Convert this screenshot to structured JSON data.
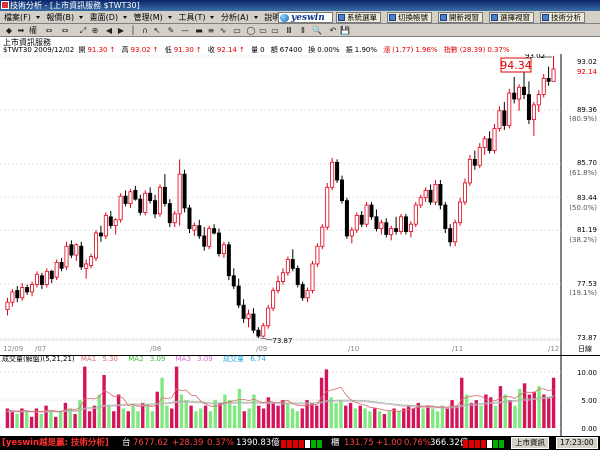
{
  "window": {
    "title": "技術分析 - [上市資訊服務 $TWT30]"
  },
  "menu": {
    "items": [
      {
        "label": "檔案(F)"
      },
      {
        "label": "報價(B)"
      },
      {
        "label": "畫面(D)"
      },
      {
        "label": "管理(M)"
      },
      {
        "label": "工具(T)"
      },
      {
        "label": "分析(A)"
      },
      {
        "label": "說明(H)"
      }
    ],
    "brand": "yeswin",
    "buttons": [
      {
        "label": "系統選單"
      },
      {
        "label": "切換帳號"
      },
      {
        "label": "開新視窗"
      },
      {
        "label": "選擇視窗"
      },
      {
        "label": "技術分析"
      }
    ]
  },
  "toolbar": {
    "items": [
      "◆",
      "➡",
      "權",
      "⇔",
      "⇔",
      "⤢",
      "⊕",
      "◀",
      "▶",
      "│",
      "∩",
      "↖",
      "✎",
      "—",
      "▬",
      "≡",
      "∿",
      "▭",
      "◯",
      "▭",
      "▭",
      "Ⅲ",
      "Ⅱ",
      "🔍",
      "↶",
      "💾"
    ]
  },
  "stock": {
    "name": "上市資訊服務",
    "symbol": "$TWT30",
    "date": "2009/12/02",
    "open_label": "開",
    "open": "91.30",
    "high_label": "高",
    "high": "93.02",
    "low_label": "低",
    "low": "91.30",
    "close_label": "收",
    "close": "92.14",
    "qty_label": "量",
    "qty": "0",
    "amount_label": "額",
    "amount": "67400",
    "turnover_label": "換",
    "turnover": "0.00%",
    "range_label": "振",
    "range": "1.90%",
    "change_label": "漲",
    "change": "(1.77)",
    "change_pct": "1.96%",
    "index_label": "指數",
    "index_change": "(28.39)",
    "index_pct": "0.37%"
  },
  "chart_data": [
    {
      "type": "candlestick",
      "title": "上市資訊服務 $TWT30",
      "x_range": [
        "2009/06",
        "2009/12/02"
      ],
      "x_tick_labels": [
        "12/09",
        "/07",
        "/08",
        "/09",
        "/10",
        "/11",
        "/12"
      ],
      "y_tick_labels": [
        "93.02",
        "92.14",
        "89.36",
        "(80.9%)",
        "85.70",
        "(61.8%)",
        "83.44",
        "(50.0%)",
        "81.19",
        "(38.2%)",
        "77.53",
        "(19.1%)",
        "73.87"
      ],
      "ylim": [
        73.87,
        93.02
      ],
      "highlight_price": "94.34",
      "high_annotation": "93.02",
      "low_annotation": "73.87",
      "ohlc": [
        [
          75.8,
          76.6,
          75.4,
          76.3
        ],
        [
          76.3,
          77.2,
          76.0,
          77.0
        ],
        [
          77.1,
          77.4,
          76.3,
          76.6
        ],
        [
          76.6,
          77.6,
          76.4,
          77.3
        ],
        [
          77.3,
          77.5,
          76.8,
          77.0
        ],
        [
          77.0,
          77.7,
          76.7,
          77.5
        ],
        [
          77.5,
          78.4,
          77.3,
          78.2
        ],
        [
          78.1,
          78.3,
          77.2,
          77.5
        ],
        [
          77.5,
          78.6,
          77.3,
          78.4
        ],
        [
          78.4,
          78.5,
          77.6,
          77.9
        ],
        [
          78.0,
          79.2,
          77.8,
          79.0
        ],
        [
          79.0,
          79.3,
          78.4,
          78.6
        ],
        [
          78.7,
          80.4,
          78.5,
          80.1
        ],
        [
          80.2,
          80.5,
          79.3,
          79.5
        ],
        [
          79.5,
          80.3,
          79.1,
          80.2
        ],
        [
          80.1,
          80.4,
          78.5,
          78.7
        ],
        [
          78.6,
          79.2,
          77.9,
          78.9
        ],
        [
          78.8,
          79.6,
          78.6,
          79.4
        ],
        [
          79.3,
          81.2,
          79.1,
          81.0
        ],
        [
          81.0,
          81.5,
          80.4,
          80.8
        ],
        [
          80.8,
          82.4,
          80.6,
          82.2
        ],
        [
          82.1,
          82.5,
          81.3,
          81.5
        ],
        [
          81.5,
          82.0,
          80.9,
          81.9
        ],
        [
          81.9,
          83.7,
          81.7,
          83.5
        ],
        [
          83.5,
          83.9,
          82.8,
          83.0
        ],
        [
          83.0,
          84.0,
          82.7,
          83.8
        ],
        [
          83.9,
          84.2,
          83.2,
          83.3
        ],
        [
          83.3,
          83.6,
          82.2,
          82.4
        ],
        [
          82.4,
          83.9,
          82.2,
          83.7
        ],
        [
          83.7,
          84.1,
          83.0,
          83.2
        ],
        [
          83.2,
          83.6,
          82.0,
          82.3
        ],
        [
          82.3,
          84.3,
          82.1,
          84.1
        ],
        [
          84.1,
          85.0,
          82.8,
          83.0
        ],
        [
          83.0,
          83.3,
          81.4,
          81.7
        ],
        [
          81.7,
          82.5,
          81.4,
          82.3
        ],
        [
          82.3,
          86.0,
          81.5,
          85.0
        ],
        [
          85.0,
          85.3,
          82.4,
          82.7
        ],
        [
          82.7,
          82.9,
          81.0,
          81.3
        ],
        [
          81.2,
          81.7,
          80.8,
          81.5
        ],
        [
          81.5,
          81.9,
          80.6,
          80.8
        ],
        [
          80.8,
          81.4,
          79.8,
          80.1
        ],
        [
          80.1,
          81.5,
          79.9,
          81.3
        ],
        [
          81.3,
          81.6,
          80.9,
          81.0
        ],
        [
          81.0,
          81.3,
          79.4,
          79.6
        ],
        [
          79.6,
          80.4,
          79.3,
          80.2
        ],
        [
          80.2,
          80.4,
          77.8,
          78.1
        ],
        [
          78.1,
          78.6,
          77.2,
          77.4
        ],
        [
          77.4,
          77.9,
          75.9,
          76.1
        ],
        [
          76.1,
          76.5,
          74.9,
          75.2
        ],
        [
          75.2,
          75.8,
          74.6,
          75.5
        ],
        [
          75.5,
          75.9,
          74.2,
          74.4
        ],
        [
          74.4,
          74.6,
          73.87,
          74.0
        ],
        [
          74.0,
          74.9,
          73.9,
          74.7
        ],
        [
          74.7,
          76.1,
          74.5,
          75.9
        ],
        [
          75.9,
          77.3,
          75.7,
          77.1
        ],
        [
          77.1,
          78.1,
          76.9,
          77.7
        ],
        [
          77.7,
          78.6,
          77.5,
          78.3
        ],
        [
          78.3,
          79.4,
          78.1,
          79.2
        ],
        [
          79.2,
          79.9,
          78.4,
          78.6
        ],
        [
          78.6,
          78.8,
          77.3,
          77.5
        ],
        [
          77.5,
          77.7,
          76.4,
          76.6
        ],
        [
          76.6,
          77.3,
          76.3,
          77.1
        ],
        [
          77.1,
          79.1,
          76.9,
          78.9
        ],
        [
          78.9,
          80.3,
          78.7,
          80.1
        ],
        [
          80.1,
          81.6,
          79.9,
          81.4
        ],
        [
          81.4,
          84.4,
          81.2,
          84.1
        ],
        [
          84.1,
          86.1,
          83.9,
          85.8
        ],
        [
          85.8,
          86.0,
          84.4,
          84.6
        ],
        [
          84.6,
          84.9,
          83.0,
          83.2
        ],
        [
          83.2,
          83.4,
          80.6,
          80.8
        ],
        [
          80.8,
          81.4,
          80.3,
          81.2
        ],
        [
          81.2,
          82.4,
          81.0,
          82.2
        ],
        [
          82.2,
          82.5,
          81.4,
          81.6
        ],
        [
          81.6,
          83.1,
          81.4,
          82.9
        ],
        [
          82.9,
          83.1,
          81.9,
          82.1
        ],
        [
          82.1,
          82.6,
          81.1,
          81.3
        ],
        [
          81.3,
          81.9,
          80.9,
          81.7
        ],
        [
          81.7,
          82.0,
          80.7,
          80.9
        ],
        [
          80.9,
          81.5,
          80.5,
          81.3
        ],
        [
          81.3,
          82.1,
          80.9,
          81.1
        ],
        [
          81.1,
          82.3,
          80.9,
          82.1
        ],
        [
          82.1,
          82.3,
          80.9,
          81.1
        ],
        [
          81.1,
          81.8,
          80.7,
          81.6
        ],
        [
          81.6,
          83.1,
          81.4,
          82.9
        ],
        [
          82.9,
          83.6,
          82.7,
          83.4
        ],
        [
          83.4,
          84.1,
          83.1,
          83.9
        ],
        [
          83.9,
          84.3,
          82.9,
          83.1
        ],
        [
          83.1,
          84.6,
          82.9,
          84.3
        ],
        [
          84.3,
          84.6,
          82.6,
          82.9
        ],
        [
          82.9,
          83.1,
          81.0,
          81.3
        ],
        [
          81.3,
          81.6,
          80.1,
          80.4
        ],
        [
          80.4,
          81.9,
          80.1,
          81.7
        ],
        [
          81.7,
          83.4,
          81.5,
          83.1
        ],
        [
          83.1,
          84.7,
          82.9,
          84.4
        ],
        [
          84.4,
          86.3,
          84.2,
          86.0
        ],
        [
          86.0,
          86.6,
          85.3,
          85.6
        ],
        [
          85.6,
          87.1,
          85.4,
          86.8
        ],
        [
          86.8,
          87.6,
          86.3,
          87.4
        ],
        [
          87.4,
          87.9,
          86.4,
          86.6
        ],
        [
          86.6,
          88.4,
          86.4,
          88.1
        ],
        [
          88.1,
          89.6,
          87.9,
          89.3
        ],
        [
          89.3,
          89.9,
          88.0,
          88.3
        ],
        [
          88.3,
          90.8,
          88.1,
          90.5
        ],
        [
          90.5,
          91.6,
          89.8,
          90.1
        ],
        [
          90.1,
          91.1,
          89.3,
          90.9
        ],
        [
          90.9,
          91.9,
          90.1,
          90.4
        ],
        [
          90.4,
          91.3,
          88.4,
          88.7
        ],
        [
          88.7,
          89.9,
          87.6,
          89.7
        ],
        [
          89.7,
          90.7,
          89.2,
          90.4
        ],
        [
          90.4,
          91.8,
          90.2,
          91.5
        ],
        [
          91.5,
          92.3,
          91.0,
          91.3
        ],
        [
          91.3,
          93.02,
          91.3,
          92.14
        ]
      ]
    },
    {
      "type": "bar",
      "title": "成交量(解盤)(5,21,21)",
      "legend": [
        {
          "name": "MA1",
          "value": "5.30"
        },
        {
          "name": "MA2",
          "value": "3.09"
        },
        {
          "name": "MA3",
          "value": "3.09"
        },
        {
          "name": "成交量",
          "value": "6.74"
        }
      ],
      "y_tick_labels": [
        "10.00",
        "5.00",
        "0.00"
      ],
      "ylim": [
        0,
        12
      ],
      "values": [
        3.5,
        3.0,
        2.5,
        3.5,
        3.0,
        2.0,
        3.5,
        2.5,
        4.0,
        3.0,
        2.0,
        3.0,
        4.5,
        3.5,
        2.5,
        5.0,
        11.0,
        3.0,
        4.0,
        6.0,
        9.5,
        4.0,
        3.0,
        6.0,
        3.5,
        3.0,
        4.0,
        3.0,
        4.5,
        4.0,
        3.0,
        6.5,
        9.0,
        4.0,
        3.5,
        11.0,
        6.0,
        5.0,
        4.0,
        3.0,
        3.5,
        4.0,
        3.0,
        5.0,
        4.5,
        6.0,
        5.0,
        4.0,
        7.0,
        3.0,
        3.5,
        6.0,
        4.0,
        3.5,
        5.5,
        4.5,
        4.0,
        5.0,
        4.5,
        3.5,
        3.0,
        3.5,
        5.0,
        4.5,
        4.0,
        9.0,
        10.5,
        5.5,
        4.5,
        5.0,
        4.0,
        4.5,
        3.5,
        4.0,
        3.5,
        3.0,
        3.5,
        3.0,
        2.5,
        3.0,
        3.5,
        3.0,
        3.5,
        4.0,
        3.5,
        4.5,
        3.5,
        4.0,
        3.5,
        3.0,
        4.0,
        3.5,
        5.0,
        4.0,
        9.0,
        6.0,
        4.5,
        5.0,
        4.0,
        6.0,
        5.5,
        4.0,
        7.5,
        6.0,
        5.0,
        4.0,
        7.0,
        8.0,
        6.0,
        6.5,
        7.5,
        6.0,
        5.5,
        9.0
      ],
      "ma1": [
        3.2,
        3.1,
        3.0,
        3.1,
        3.1,
        2.9,
        3.0,
        2.9,
        3.1,
        3.2,
        3.0,
        2.9,
        3.3,
        3.4,
        3.3,
        3.6,
        5.3,
        5.3,
        5.2,
        5.6,
        6.7,
        6.3,
        5.6,
        5.8,
        5.3,
        4.0,
        4.2,
        3.9,
        3.9,
        4.1,
        3.8,
        4.2,
        5.4,
        5.3,
        5.4,
        7.0,
        6.7,
        6.8,
        5.9,
        5.8,
        4.8,
        4.3,
        3.9,
        3.9,
        4.0,
        4.5,
        4.7,
        4.9,
        5.1,
        5.1,
        4.9,
        5.2,
        4.8,
        4.5,
        4.8,
        4.6,
        4.5,
        4.8,
        4.9,
        4.4,
        4.1,
        4.0,
        4.0,
        4.1,
        4.2,
        5.5,
        6.5,
        6.8,
        7.0,
        7.3,
        6.0,
        5.1,
        4.6,
        4.3,
        4.1,
        3.7,
        3.6,
        3.4,
        3.2,
        3.1,
        3.1,
        3.0,
        3.1,
        3.3,
        3.5,
        3.7,
        3.9,
        4.0,
        3.9,
        3.7,
        3.8,
        3.7,
        3.9,
        3.9,
        5.1,
        5.5,
        5.7,
        5.8,
        5.7,
        5.1,
        5.0,
        4.9,
        5.4,
        5.6,
        5.6,
        5.3,
        5.9,
        6.4,
        6.4,
        6.3,
        7.0,
        7.0,
        6.7,
        6.9
      ],
      "ma2": [
        3.0,
        3.0,
        3.0,
        3.0,
        3.0,
        3.0,
        3.0,
        3.0,
        3.0,
        3.0,
        3.0,
        3.0,
        3.1,
        3.1,
        3.1,
        3.2,
        3.6,
        3.6,
        3.7,
        3.8,
        4.1,
        4.1,
        4.1,
        4.2,
        4.2,
        4.3,
        4.3,
        4.3,
        4.3,
        4.3,
        4.3,
        4.4,
        4.5,
        4.5,
        4.6,
        4.8,
        4.8,
        4.8,
        4.8,
        4.7,
        4.7,
        4.6,
        4.5,
        4.5,
        4.5,
        4.6,
        4.6,
        4.6,
        4.7,
        4.6,
        4.6,
        4.7,
        4.6,
        4.6,
        4.6,
        4.6,
        4.5,
        4.5,
        4.5,
        4.5,
        4.5,
        4.5,
        4.5,
        4.5,
        4.5,
        4.7,
        4.9,
        4.9,
        5.0,
        5.0,
        5.0,
        5.0,
        4.9,
        4.9,
        4.9,
        4.8,
        4.7,
        4.6,
        4.5,
        4.4,
        4.3,
        4.2,
        4.1,
        4.1,
        4.0,
        4.0,
        3.9,
        3.9,
        3.8,
        3.8,
        3.8,
        3.7,
        3.8,
        3.8,
        4.1,
        4.2,
        4.3,
        4.3,
        4.4,
        4.5,
        4.6,
        4.6,
        4.7,
        4.8,
        4.9,
        4.9,
        5.1,
        5.2,
        5.2,
        5.3,
        5.4,
        5.5,
        5.5,
        5.8
      ],
      "ma3": [
        2.9,
        2.9,
        2.9,
        2.9,
        2.9,
        2.9,
        2.9,
        2.9,
        2.9,
        2.9,
        2.9,
        2.9,
        3.0,
        3.0,
        3.0,
        3.1,
        3.4,
        3.4,
        3.5,
        3.6,
        3.9,
        3.9,
        3.9,
        4.0,
        4.0,
        4.1,
        4.1,
        4.1,
        4.1,
        4.1,
        4.1,
        4.2,
        4.3,
        4.3,
        4.4,
        4.6,
        4.6,
        4.6,
        4.6,
        4.5,
        4.5,
        4.4,
        4.3,
        4.3,
        4.3,
        4.4,
        4.4,
        4.4,
        4.5,
        4.4,
        4.4,
        4.5,
        4.4,
        4.4,
        4.4,
        4.4,
        4.3,
        4.3,
        4.3,
        4.3,
        4.3,
        4.3,
        4.3,
        4.3,
        4.3,
        4.5,
        4.7,
        4.7,
        4.8,
        4.8,
        4.8,
        4.8,
        4.7,
        4.7,
        4.7,
        4.6,
        4.5,
        4.4,
        4.3,
        4.2,
        4.1,
        4.0,
        3.9,
        3.9,
        3.8,
        3.8,
        3.7,
        3.7,
        3.6,
        3.6,
        3.6,
        3.5,
        3.6,
        3.6,
        3.9,
        4.0,
        4.1,
        4.1,
        4.2,
        4.3,
        4.4,
        4.4,
        4.5,
        4.6,
        4.7,
        4.7,
        4.9,
        5.0,
        5.0,
        5.1,
        5.2,
        5.3,
        5.3,
        5.6
      ]
    }
  ],
  "status": {
    "left_label": "[yeswin越是贏: 技術分析]",
    "taiex_label": "台",
    "taiex": "7677.62",
    "taiex_change": "+28.39",
    "taiex_pct": "0.37%",
    "taiex_amount": "1390.83億",
    "otc_label": "櫃",
    "otc": "131.75",
    "otc_change": "+1.00",
    "otc_pct": "0.76%",
    "otc_amount": "366.32億",
    "tab": "上市資訊",
    "time": "17:23:00"
  },
  "colors": {
    "up": "#e0001a",
    "down": "#000000",
    "vol_up": "#d4145a",
    "vol_down": "#80e880",
    "ma1": "#d86a6a",
    "ma2": "#90c090",
    "ma3": "#d8a8d8"
  }
}
